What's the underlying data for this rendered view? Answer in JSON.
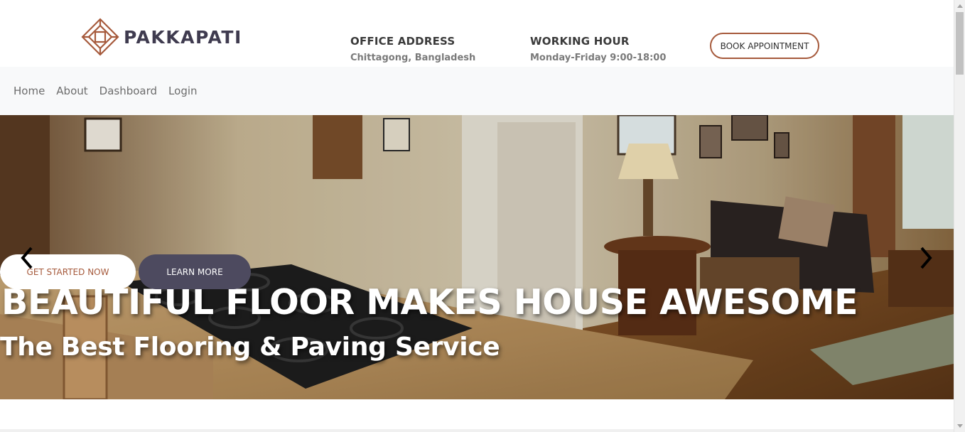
{
  "brand": {
    "name": "PAKKAPATI",
    "accent": "#a65a3c",
    "dark": "#3f3b4f"
  },
  "header": {
    "office": {
      "label": "OFFICE ADDRESS",
      "value": "Chittagong, Bangladesh"
    },
    "hours": {
      "label": "WORKING HOUR",
      "value": "Monday-Friday 9:00-18:00"
    },
    "book_label": "BOOK APPOINTMENT"
  },
  "nav": {
    "items": [
      {
        "label": "Home"
      },
      {
        "label": "About"
      },
      {
        "label": "Dashboard"
      },
      {
        "label": "Login"
      }
    ]
  },
  "hero": {
    "title": "BEAUTIFUL FLOOR MAKES HOUSE AWESOME",
    "subtitle": "The Best Flooring & Paving Service",
    "primary_label": "GET STARTED NOW",
    "secondary_label": "LEARN MORE",
    "prev_icon": "chevron-left-icon",
    "next_icon": "chevron-right-icon",
    "image": "kitchen-living-room-photo"
  }
}
